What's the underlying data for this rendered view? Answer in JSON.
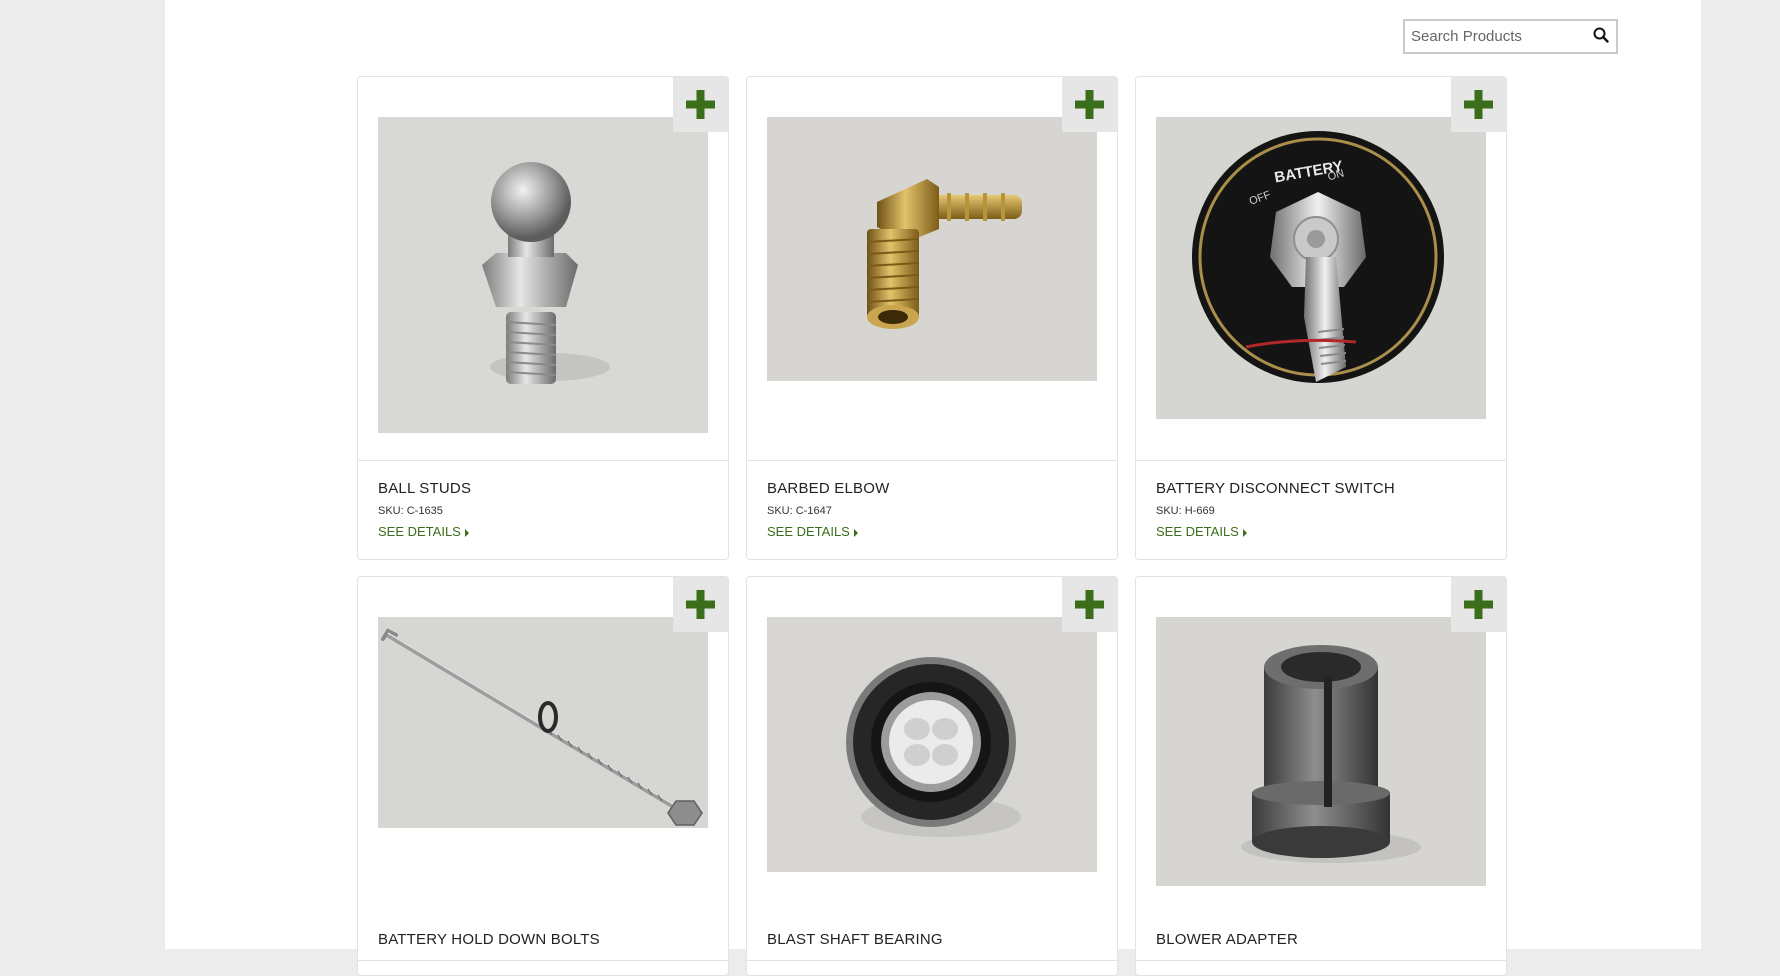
{
  "search": {
    "placeholder": "Search Products",
    "value": ""
  },
  "accent_color": "#3b6e1a",
  "add_icon": "plus-icon",
  "products": [
    {
      "name": "BALL STUDS",
      "sku": "SKU: C-1635",
      "details_label": "SEE DETAILS"
    },
    {
      "name": "BARBED ELBOW",
      "sku": "SKU: C-1647",
      "details_label": "SEE DETAILS"
    },
    {
      "name": "BATTERY DISCONNECT SWITCH",
      "sku": "SKU: H-669",
      "details_label": "SEE DETAILS"
    },
    {
      "name": "BATTERY HOLD DOWN BOLTS"
    },
    {
      "name": "BLAST SHAFT BEARING"
    },
    {
      "name": "BLOWER ADAPTER"
    }
  ],
  "switch_labels": {
    "title": "BATTERY",
    "off": "OFF",
    "on": "ON"
  }
}
